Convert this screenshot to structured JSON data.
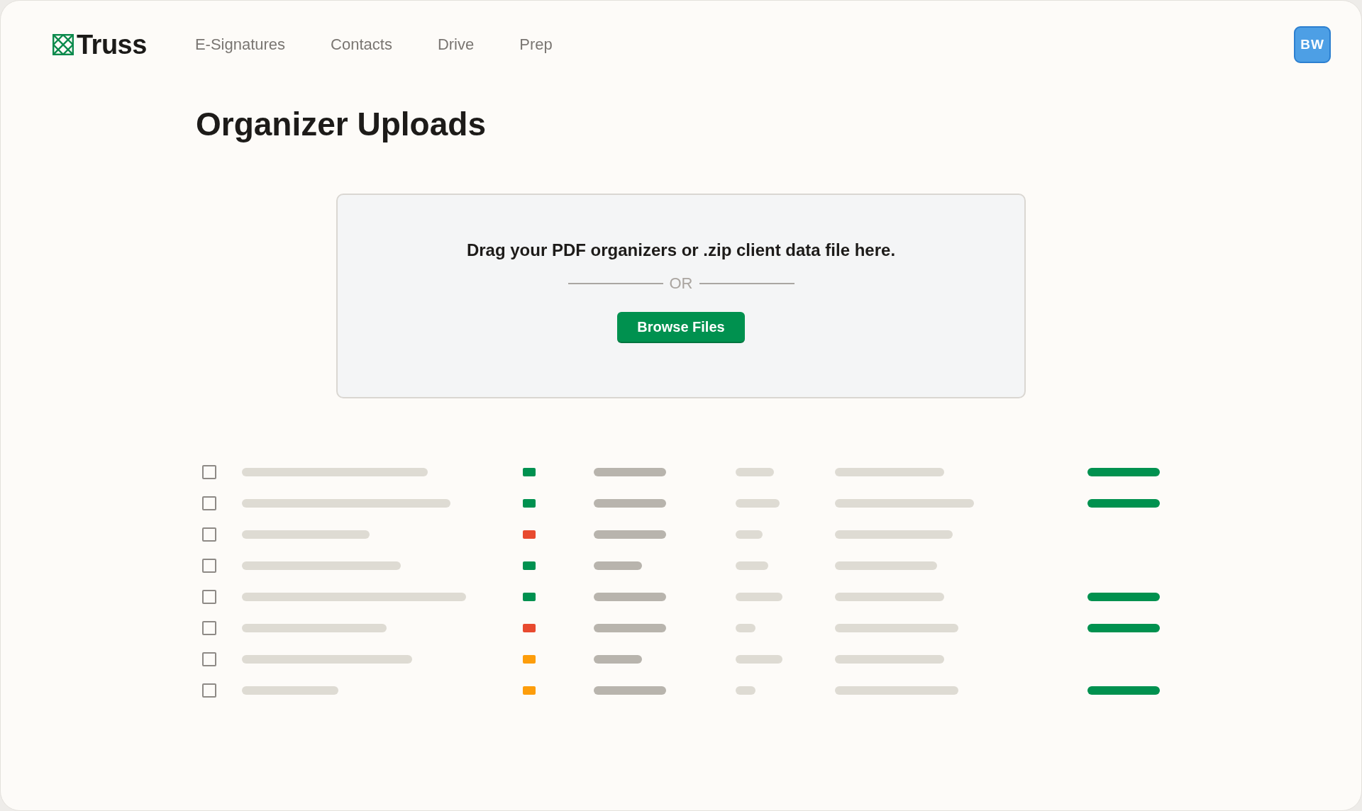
{
  "header": {
    "logo": "Truss",
    "nav": [
      {
        "label": "E-Signatures",
        "selected": false
      },
      {
        "label": "Contacts",
        "selected": false
      },
      {
        "label": "Drive",
        "selected": false
      },
      {
        "label": "Prep",
        "selected": false
      }
    ],
    "avatar": "BW"
  },
  "title": "Organizer Uploads",
  "dropzone": {
    "instructions": "Drag your PDF organizers or .zip client data file here.",
    "separator": "OR",
    "button": "Browse Files"
  },
  "table": {
    "rows": [
      {
        "checked": false,
        "color": "#009150",
        "complete": true
      },
      {
        "checked": false,
        "color": "#009150",
        "complete": true
      },
      {
        "checked": false,
        "color": "#e84a2f",
        "complete": false
      },
      {
        "checked": false,
        "color": "#009150",
        "complete": false
      },
      {
        "checked": false,
        "color": "#009150",
        "complete": true
      },
      {
        "checked": false,
        "color": "#e84a2f",
        "complete": true
      },
      {
        "checked": false,
        "color": "#fd9d0b",
        "complete": false
      },
      {
        "checked": false,
        "color": "#fd9d0b",
        "complete": true
      }
    ]
  }
}
